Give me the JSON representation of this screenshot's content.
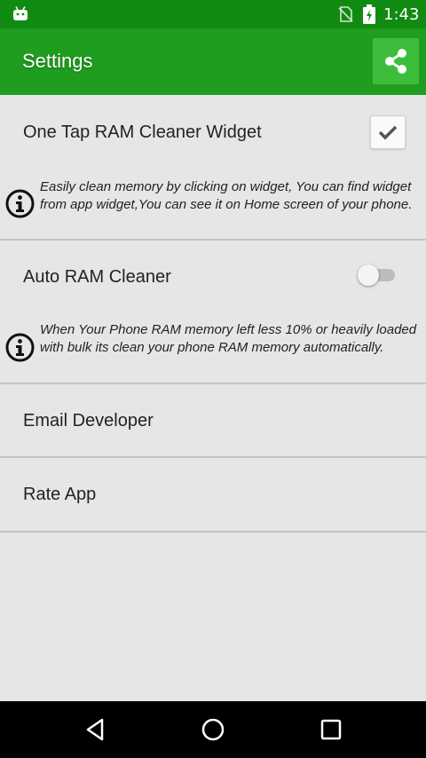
{
  "status_bar": {
    "time": "1:43",
    "icons": [
      "android-icon",
      "no-sim-icon",
      "battery-charging-icon"
    ],
    "color": "#118a11"
  },
  "app_bar": {
    "title": "Settings",
    "share_icon": "share-icon",
    "color": "#1f9d1f",
    "share_button_color": "#3cbe3c"
  },
  "settings": {
    "widget": {
      "title": "One Tap RAM Cleaner Widget",
      "checked": true,
      "info": "Easily clean memory by clicking on widget, You can find widget from app widget,You can see it on Home screen of your phone."
    },
    "auto_clean": {
      "title": "Auto RAM Cleaner",
      "enabled": false,
      "info": "When Your Phone RAM memory left less 10% or heavily loaded with bulk its clean your phone RAM memory automatically."
    },
    "email": {
      "title": "Email Developer"
    },
    "rate": {
      "title": "Rate App"
    }
  },
  "nav_bar": {
    "icons": [
      "back-icon",
      "home-icon",
      "recents-icon"
    ]
  }
}
